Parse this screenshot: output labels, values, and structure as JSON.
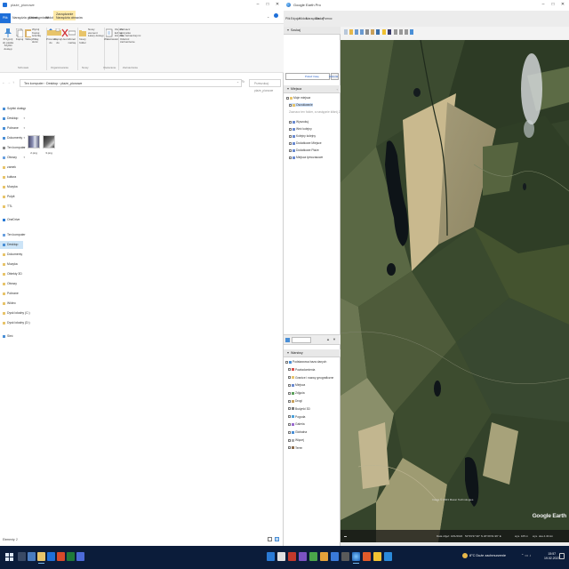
{
  "explorer": {
    "window_title": "plaże_pionowe",
    "tabs": [
      "Plik",
      "Narzędzia główne",
      "Udostępnianie",
      "Widok",
      "Narzędzia obrazów"
    ],
    "context_tab": "Zarządzanie",
    "ribbon": {
      "pin": "Przypnij do paska Szybki dostęp",
      "copy": "Kopiuj",
      "paste": "Wklej",
      "cut": "Wytnij",
      "copy_path": "Kopiuj ścieżkę",
      "paste_shortcut": "Wklej skrót",
      "move_to": "Przenieś do",
      "copy_to": "Kopiuj do",
      "delete": "Usuń",
      "rename": "Zmień nazwę",
      "new_folder": "Nowy folder",
      "new_item": "Nowy element",
      "easy_access": "Łatwy dostęp",
      "properties": "Właściwości",
      "open": "Otwórz",
      "edit": "Edytuj",
      "history": "Historia",
      "select_all": "Zaznacz wszystko",
      "select_none": "Nie zaznaczaj nic",
      "invert_selection": "Odwróć zaznaczenie",
      "groups": [
        "Schowek",
        "Organizowanie",
        "Nowy",
        "Otwieranie",
        "Zaznaczanie"
      ]
    },
    "address": {
      "crumbs": [
        "Ten komputer",
        "Desktop",
        "plaże_pionowe"
      ],
      "search_placeholder": "Przeszukaj: plaże_pionowe"
    },
    "nav": {
      "quick_access": "Szybki dostęp",
      "pinned": [
        "Desktop",
        "Pobrane",
        "Dokumenty",
        "Ten komputer",
        "Obrazy",
        "zamek",
        "kultura",
        "Muzyka",
        "Pulpit",
        "TTL"
      ],
      "onedrive": "OneDrive",
      "this_pc": "Ten komputer",
      "pc_items": [
        "Desktop",
        "Dokumenty",
        "Muzyka",
        "Obiekty 3D",
        "Obrazy",
        "Pobrane",
        "Wideo",
        "Dysk lokalny (C:)",
        "Dysk lokalny (D:)"
      ],
      "network": "Sieć"
    },
    "files": [
      {
        "name": "2.png"
      },
      {
        "name": "3.png"
      }
    ],
    "status": "Elementy: 2"
  },
  "earth": {
    "window_title": "Google Earth Pro",
    "menu": [
      "Plik",
      "Edycja",
      "Widok",
      "Narzędzia",
      "Dodaj",
      "Pomoc"
    ],
    "search_header": "Szukaj",
    "search_links": [
      "Pokaż trasę",
      "Historia"
    ],
    "places_header": "Miejsca",
    "places": [
      {
        "label": "Moje miejsca",
        "style": "normal"
      },
      {
        "label": "Oszukiwanie",
        "style": "hl"
      },
      {
        "label": "Zaznacz ten folder, a następnie kliknij Zapisz",
        "style": "grey"
      },
      {
        "label": "Wyszukuj",
        "style": "normal"
      },
      {
        "label": "Weź kolejny",
        "style": "normal"
      },
      {
        "label": "Kolejny kolejny",
        "style": "normal"
      },
      {
        "label": "Dodatkowe Miejsce",
        "style": "normal"
      },
      {
        "label": "Dodatkowe Plaże",
        "style": "normal"
      },
      {
        "label": "Miejsca tymczasowe",
        "style": "normal"
      }
    ],
    "layers_header": "Warstwy",
    "layers": [
      "Podstawowa baza danych",
      "Powiadomienia",
      "Granice i nazwy geograficzne",
      "Miejsca",
      "Zdjęcia",
      "Drogi",
      "Budynki 3D",
      "Pogoda",
      "Galeria",
      "Globalna",
      "Więcej",
      "Teren"
    ],
    "map_attribution": "Image © 2023 Maxar Technologies",
    "logo": "Google Earth",
    "status": {
      "date": "Data zdjęć: 4/21/2022",
      "coords": "52°09'37.90\" N  20°29'31.96\" E",
      "elev": "wys. 105 m",
      "eye": "wys. oka 4.43 km"
    }
  },
  "taskbar": {
    "weather": "8°C  Duże zachmurzenie",
    "time": "15:57",
    "date": "19.02.2023"
  }
}
